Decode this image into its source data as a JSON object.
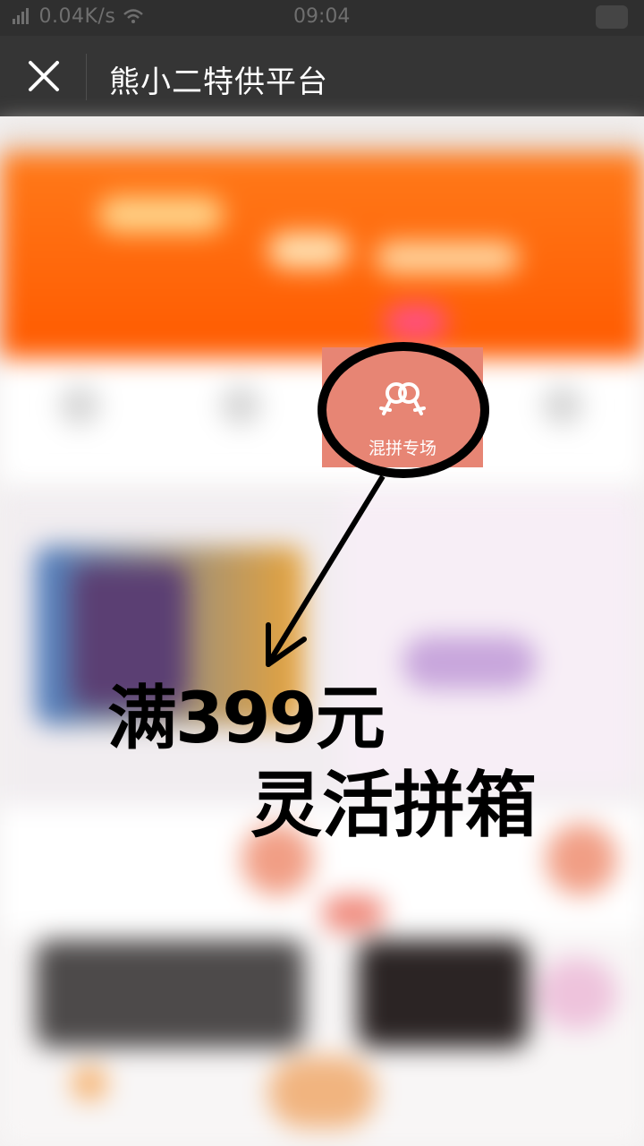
{
  "status_bar": {
    "network_speed": "0.04K/s",
    "time": "09:04"
  },
  "navbar": {
    "title": "熊小二特供平台"
  },
  "highlight_tile": {
    "label": "混拼专场"
  },
  "annotation": {
    "line1": "满399元",
    "line2": "灵活拼箱"
  },
  "colors": {
    "tile_bg": "#e78574",
    "banner_orange": "#ff6a00",
    "nav_bg": "#353535"
  },
  "icons": {
    "close": "close-icon",
    "signal": "signal-icon",
    "wifi": "wifi-icon",
    "mix": "female-symbols-icon"
  }
}
